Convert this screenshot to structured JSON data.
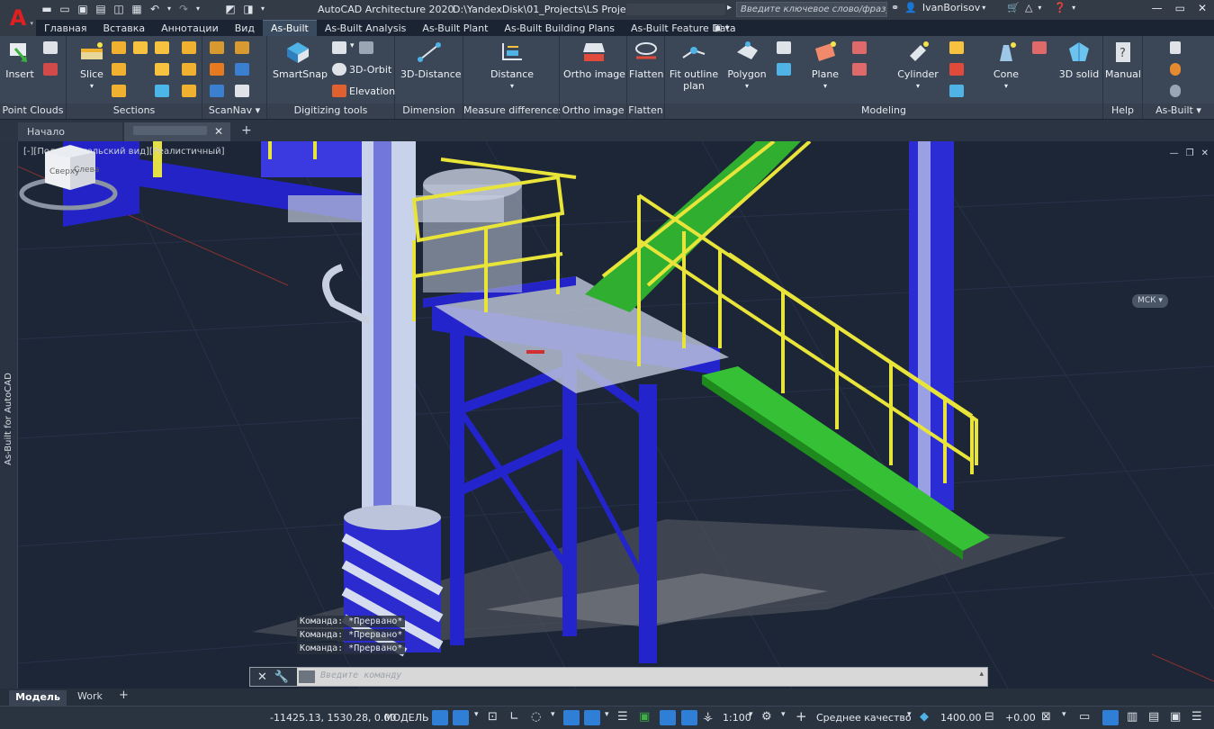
{
  "titlebar": {
    "app_title": "AutoCAD Architecture 2020",
    "path": "D:\\YandexDisk\\01_Projects\\LS Proje...\\",
    "search_placeholder": "Введите ключевое слово/фразу",
    "username": "IvanBorisov"
  },
  "ribbon_tabs": [
    "Главная",
    "Вставка",
    "Аннотации",
    "Вид",
    "As-Built",
    "As-Built Analysis",
    "As-Built Plant",
    "As-Built Building Plans",
    "As-Built Feature Data"
  ],
  "active_tab": "As-Built",
  "ribbon": {
    "groups": {
      "point_clouds": "Point Clouds",
      "sections": "Sections",
      "scannav": "ScanNav",
      "digitizing": "Digitizing tools",
      "dimension": "Dimension",
      "measure": "Measure differences",
      "ortho": "Ortho image",
      "flatten": "Flatten",
      "modeling": "Modeling",
      "help": "Help",
      "asbuilt": "As-Built"
    },
    "buttons": {
      "insert": "Insert",
      "slice": "Slice",
      "smartsnap": "SmartSnap",
      "orbit": "3D-Orbit",
      "elevation": "Elevation",
      "distance3d": "3D-Distance",
      "distance": "Distance",
      "ortho_image": "Ortho image",
      "flatten": "Flatten",
      "fit_outline_1": "Fit outline",
      "fit_outline_2": "plan",
      "polygon": "Polygon",
      "plane": "Plane",
      "cylinder": "Cylinder",
      "cone": "Cone",
      "solid3d": "3D solid",
      "manual": "Manual"
    }
  },
  "doc_tabs": {
    "home": "Начало"
  },
  "viewport": {
    "label": "[-][Пользовательский вид][Реалистичный]",
    "viewcube_left": "Сверху",
    "viewcube_right": "Слева",
    "ucs": "МСК"
  },
  "side_palette": "As-Built for AutoCAD",
  "command": {
    "history": [
      "Команда: *Прервано*",
      "Команда: *Прервано*",
      "Команда: *Прервано*"
    ],
    "placeholder": "Введите команду"
  },
  "layout_tabs": [
    "Модель",
    "Work"
  ],
  "status": {
    "coords": "-11425.13, 1530.28, 0.00",
    "model": "МОДЕЛЬ",
    "scale": "1:100",
    "quality": "Среднее качество",
    "point_size": "1400.00",
    "offset": "+0.00"
  }
}
